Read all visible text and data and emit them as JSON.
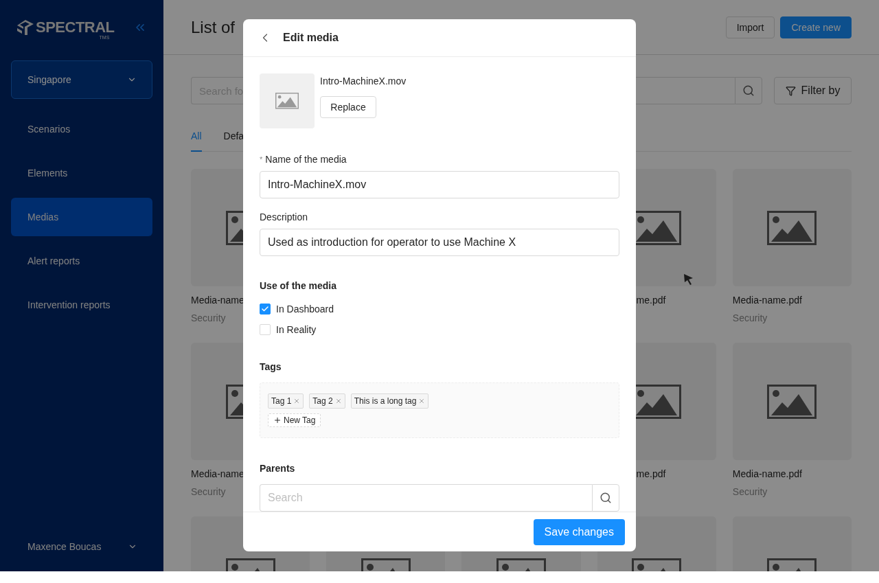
{
  "sidebar": {
    "logo": {
      "name": "SPECTRAL",
      "suffix": "TMS"
    },
    "site_select": {
      "value": "Singapore"
    },
    "items": [
      {
        "label": "Scenarios",
        "selected": false
      },
      {
        "label": "Elements",
        "selected": false
      },
      {
        "label": "Medias",
        "selected": true
      },
      {
        "label": "Alert reports",
        "selected": false
      },
      {
        "label": "Intervention reports",
        "selected": false
      }
    ],
    "user": {
      "name": "Maxence Boucas"
    }
  },
  "page": {
    "title": "List of",
    "actions": [
      {
        "label": "Import",
        "kind": "default"
      },
      {
        "label": "Create new",
        "kind": "primary"
      }
    ],
    "search": {
      "placeholder": "Search fo"
    },
    "filter_button": "Filter by",
    "tabs": [
      {
        "label": "All",
        "selected": true
      },
      {
        "label": "Defa",
        "selected": false
      }
    ],
    "media_rows": [
      [
        {
          "kind": "card",
          "name": "Media-name",
          "category": "Security"
        },
        {
          "kind": "covered"
        },
        {
          "kind": "covered"
        },
        {
          "kind": "cut",
          "name": "me.pdf"
        },
        {
          "kind": "card",
          "name": "Media-name.pdf",
          "category": "Security"
        }
      ],
      [
        {
          "kind": "card",
          "name": "Media-name",
          "category": "Security"
        },
        {
          "kind": "covered"
        },
        {
          "kind": "covered"
        },
        {
          "kind": "cut",
          "name": "me.pdf"
        },
        {
          "kind": "card",
          "name": "Media-name.pdf",
          "category": "Security"
        }
      ],
      [
        {
          "kind": "card"
        },
        {
          "kind": "card"
        },
        {
          "kind": "card"
        },
        {
          "kind": "card"
        },
        {
          "kind": "card"
        }
      ]
    ]
  },
  "modal": {
    "title": "Edit media",
    "file": {
      "name": "Intro-MachineX.mov",
      "replace_label": "Replace"
    },
    "fields": [
      {
        "label": "Name of the media",
        "required_mark": "*",
        "value": "Intro-MachineX.mov"
      },
      {
        "label": "Description",
        "value": "Used as introduction for operator to use Machine X"
      }
    ],
    "usage": {
      "label": "Use of the media",
      "options": [
        {
          "label": "In Dashboard",
          "checked": true
        },
        {
          "label": "In Reality",
          "checked": false
        }
      ]
    },
    "tags": {
      "label": "Tags",
      "items": [
        "Tag 1",
        "Tag 2",
        "This is a long tag"
      ],
      "add_label": "New Tag"
    },
    "parents": {
      "label": "Parents",
      "placeholder": "Search"
    },
    "save_label": "Save changes"
  }
}
